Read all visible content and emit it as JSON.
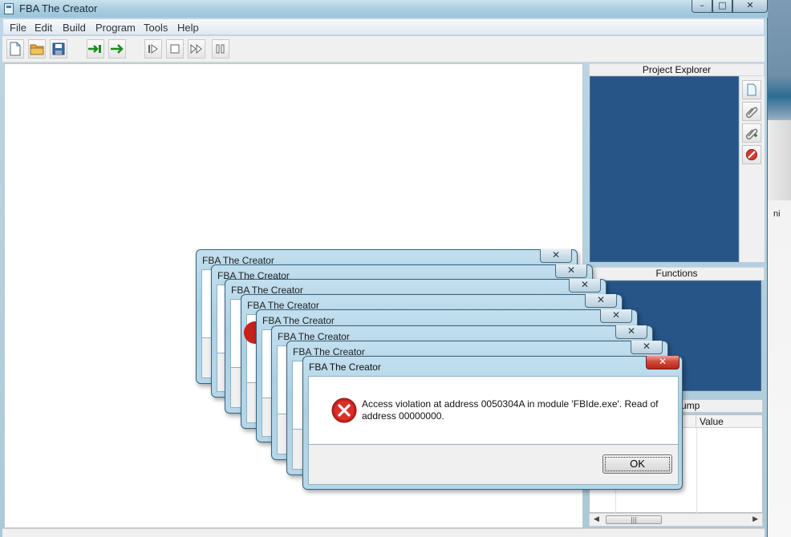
{
  "app": {
    "title": "FBA The Creator",
    "caption_buttons": {
      "minimize": "–",
      "maximize": "□",
      "close": "✕"
    }
  },
  "menu": [
    "File",
    "Edit",
    "Build",
    "Program",
    "Tools",
    "Help"
  ],
  "toolbar": {
    "icons": [
      "new-file-icon",
      "open-folder-icon",
      "save-icon",
      "compile-icon",
      "run-icon",
      "step-icon",
      "stop-icon",
      "fast-forward-icon",
      "pause-icon"
    ]
  },
  "panels": {
    "project_explorer": "Project Explorer",
    "functions": "Functions",
    "dump_tab": "ump",
    "grid_value_header": "Value",
    "explorer_tools": [
      "new-item-icon",
      "attach-icon",
      "attach-add-icon",
      "remove-icon"
    ]
  },
  "background": {
    "right_label": "ni"
  },
  "dialogs": {
    "title": "FBA The Creator",
    "close_symbol": "✕",
    "message": "Access violation at address 0050304A in module 'FBIde.exe'. Read of address 00000000.",
    "ok_label": "OK"
  },
  "colors": {
    "tree_bg": "#275587",
    "error_red": "#c8201b",
    "close_button_red": "#d2483a"
  }
}
